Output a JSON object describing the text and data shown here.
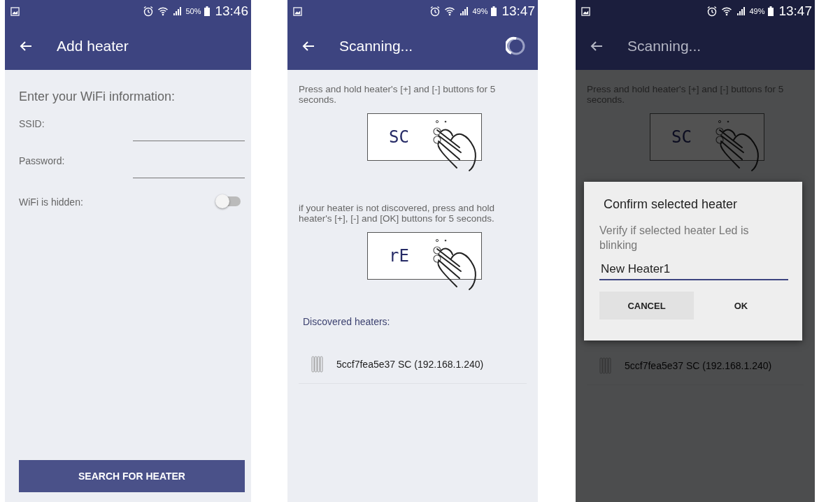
{
  "screens": [
    {
      "kind": "form",
      "dimmed": false,
      "status_bar": {
        "battery": "50%",
        "time": "13:46"
      },
      "app_bar": {
        "title": "Add heater",
        "busy": false
      },
      "heading": "Enter your WiFi information:",
      "fields": [
        {
          "label": "SSID:"
        },
        {
          "label": "Password:"
        }
      ],
      "toggle": {
        "label": "WiFi is hidden:",
        "on": false
      },
      "button": "SEARCH FOR HEATER"
    },
    {
      "kind": "scan",
      "dimmed": false,
      "status_bar": {
        "battery": "49%",
        "time": "13:47"
      },
      "app_bar": {
        "title": "Scanning...",
        "busy": true
      },
      "steps": [
        {
          "text": "Press and hold heater's [+] and [-] buttons for 5 seconds.",
          "display": "SC"
        },
        {
          "text": "if your heater is not discovered, press and hold heater's [+], [-] and [OK] buttons for 5 seconds.",
          "display": "rE"
        }
      ],
      "discovered_heading": "Discovered heaters:",
      "heaters": [
        {
          "name": "5ccf7fea5e37 SC (192.168.1.240)"
        }
      ]
    },
    {
      "kind": "scan",
      "dimmed": true,
      "status_bar": {
        "battery": "49%",
        "time": "13:47"
      },
      "app_bar": {
        "title": "Scanning...",
        "busy": false
      },
      "steps": [
        {
          "text": "Press and hold heater's [+] and [-] buttons for 5 seconds.",
          "display": "SC"
        }
      ],
      "heaters": [
        {
          "name": "5ccf7fea5e37 SC (192.168.1.240)"
        }
      ],
      "dialog": {
        "title": "Confirm selected heater",
        "message": "Verify if selected heater Led is blinking",
        "value": "New Heater1",
        "buttons": [
          "CANCEL",
          "OK"
        ]
      }
    }
  ]
}
